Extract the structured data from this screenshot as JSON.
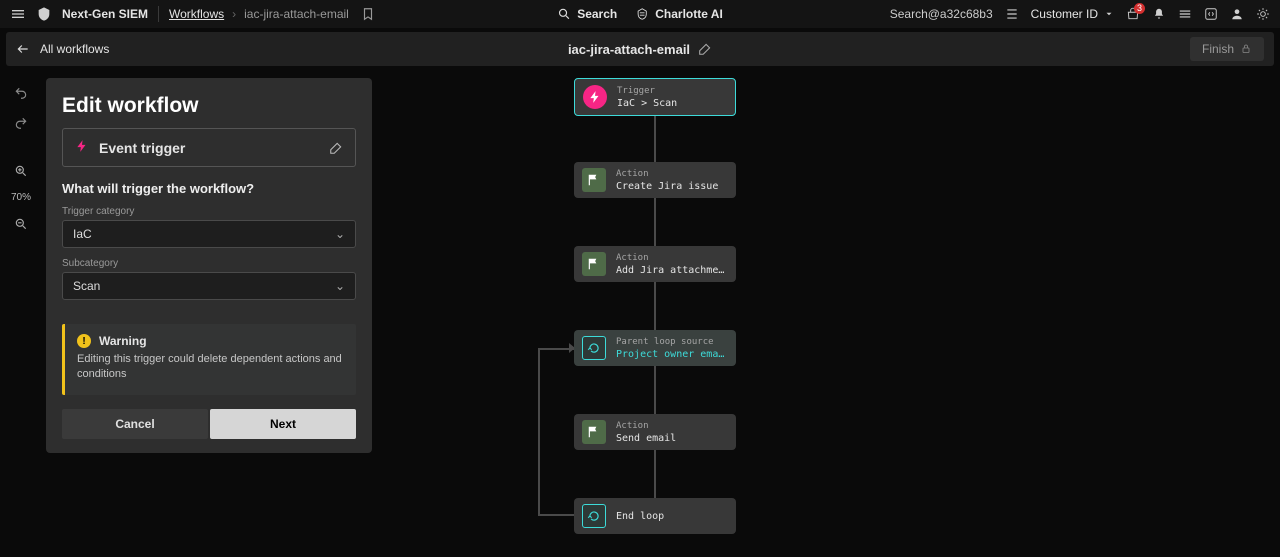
{
  "topbar": {
    "product": "Next-Gen SIEM",
    "crumb_workflows": "Workflows",
    "crumb_name": "iac-jira-attach-email",
    "search_label": "Search",
    "charlotte_label": "Charlotte AI",
    "search_hash": "Search@a32c68b3",
    "customer_label": "Customer ID",
    "notif_count": "3"
  },
  "wfbar": {
    "back_label": "All workflows",
    "title": "iac-jira-attach-email",
    "finish_label": "Finish"
  },
  "zoom": {
    "value": "70%"
  },
  "panel": {
    "heading": "Edit workflow",
    "trigger_label": "Event trigger",
    "prompt": "What will trigger the workflow?",
    "cat_label": "Trigger category",
    "cat_value": "IaC",
    "sub_label": "Subcategory",
    "sub_value": "Scan",
    "warn_title": "Warning",
    "warn_body": "Editing this trigger could delete dependent actions and conditions",
    "cancel": "Cancel",
    "next": "Next"
  },
  "nodes": {
    "n0": {
      "type": "Trigger",
      "name": "IaC > Scan"
    },
    "n1": {
      "type": "Action",
      "name": "Create Jira issue"
    },
    "n2": {
      "type": "Action",
      "name": "Add Jira attachment"
    },
    "n3": {
      "type": "Parent loop source",
      "name": "Project owner email addre…"
    },
    "n4": {
      "type": "Action",
      "name": "Send email"
    },
    "n5": {
      "type": "",
      "name": "End loop"
    }
  }
}
